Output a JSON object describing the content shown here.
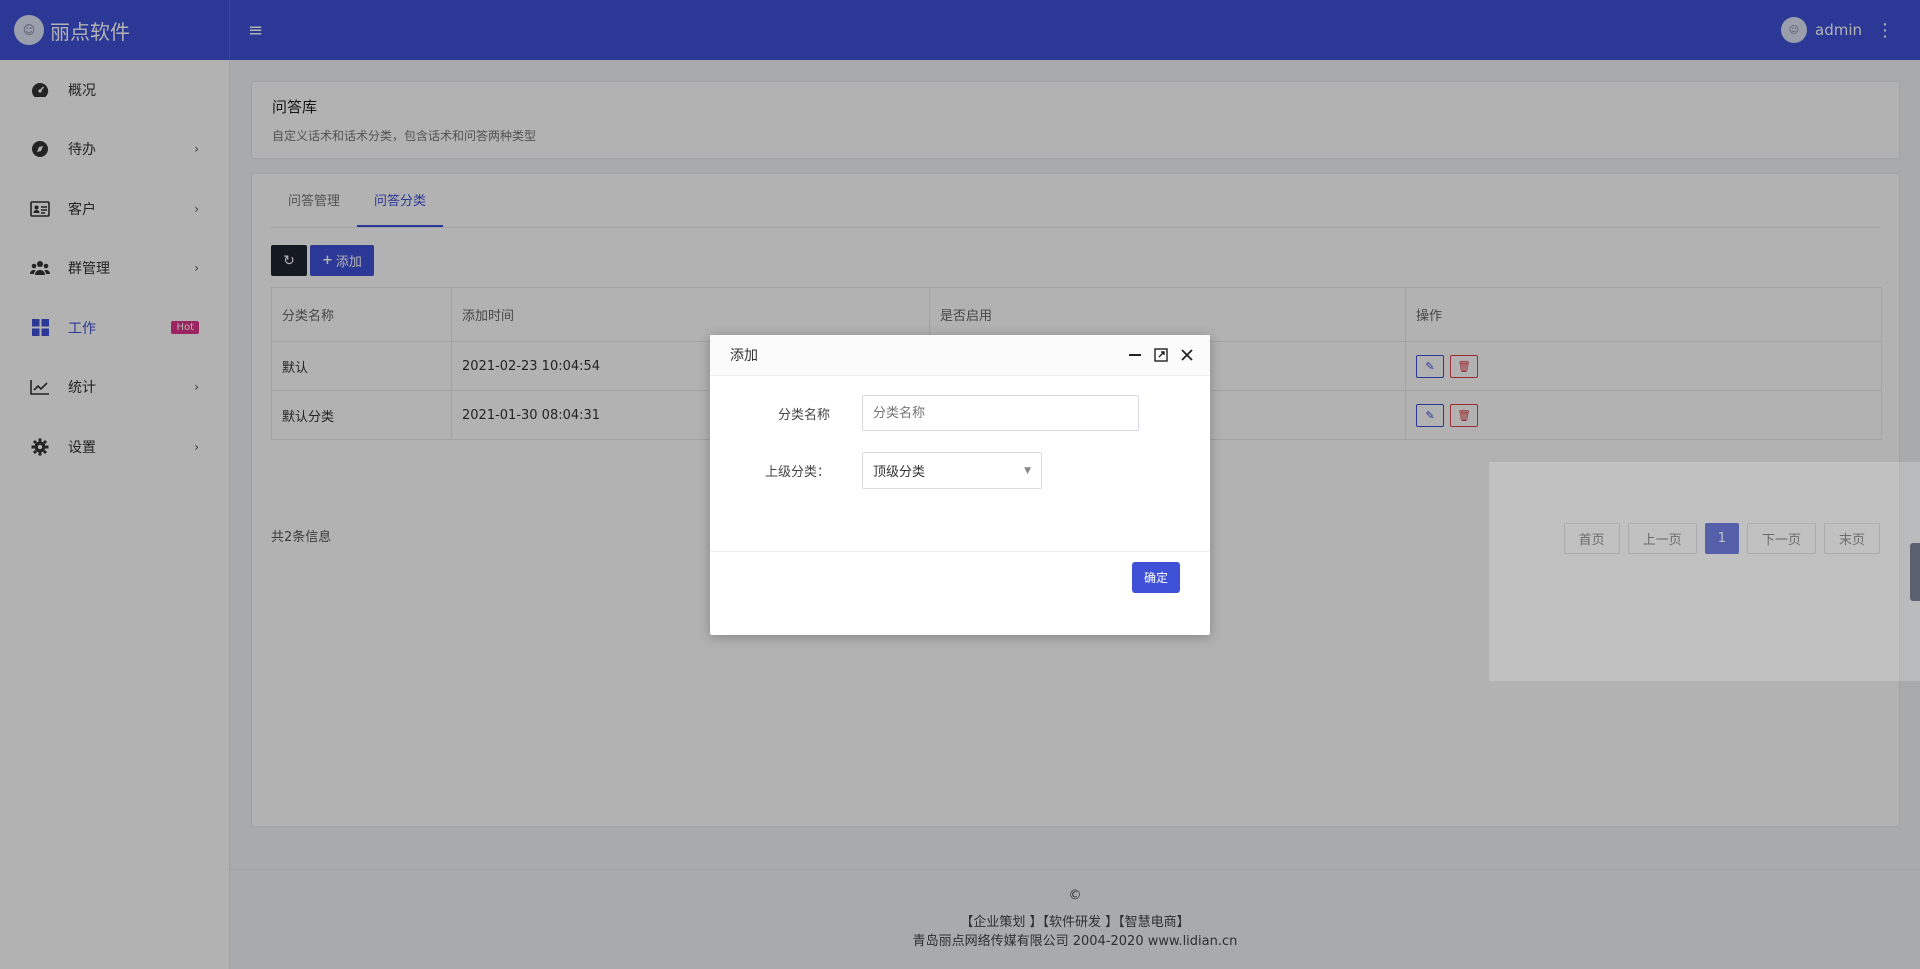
{
  "header": {
    "brand_name": "丽点软件",
    "username": "admin"
  },
  "sidebar": {
    "items": [
      {
        "label": "概况",
        "icon": "dashboard-icon"
      },
      {
        "label": "待办",
        "icon": "compass-icon"
      },
      {
        "label": "客户",
        "icon": "id-card-icon"
      },
      {
        "label": "群管理",
        "icon": "users-icon"
      },
      {
        "label": "工作",
        "icon": "grid-icon",
        "badge": "Hot"
      },
      {
        "label": "统计",
        "icon": "chart-line-icon"
      },
      {
        "label": "设置",
        "icon": "gear-icon"
      }
    ]
  },
  "intro": {
    "title": "问答库",
    "subtitle": "自定义话术和话术分类，包含话术和问答两种类型"
  },
  "tabs": [
    {
      "label": "问答管理"
    },
    {
      "label": "问答分类"
    }
  ],
  "toolbar": {
    "add_label": "添加"
  },
  "table": {
    "headers": [
      "分类名称",
      "添加时间",
      "是否启用",
      "操作"
    ],
    "rows": [
      {
        "name": "默认",
        "time": "2021-02-23 10:04:54"
      },
      {
        "name": "默认分类",
        "time": "2021-01-30 08:04:31"
      }
    ]
  },
  "summary": "共2条信息",
  "pager": {
    "first": "首页",
    "prev": "上一页",
    "current": "1",
    "next": "下一页",
    "last": "末页"
  },
  "footer": {
    "copyright": "©",
    "links": "【企业策划 】【软件研发 】【智慧电商】",
    "company": "青岛丽点网络传媒有限公司 2004-2020 www.lidian.cn"
  },
  "modal": {
    "title": "添加",
    "name_label": "分类名称",
    "name_placeholder": "分类名称",
    "parent_label": "上级分类：",
    "parent_value": "顶级分类",
    "ok_label": "确定"
  },
  "colors": {
    "primary": "#3f51d6",
    "hot_badge": "#e0348c",
    "danger": "#e0434a"
  }
}
